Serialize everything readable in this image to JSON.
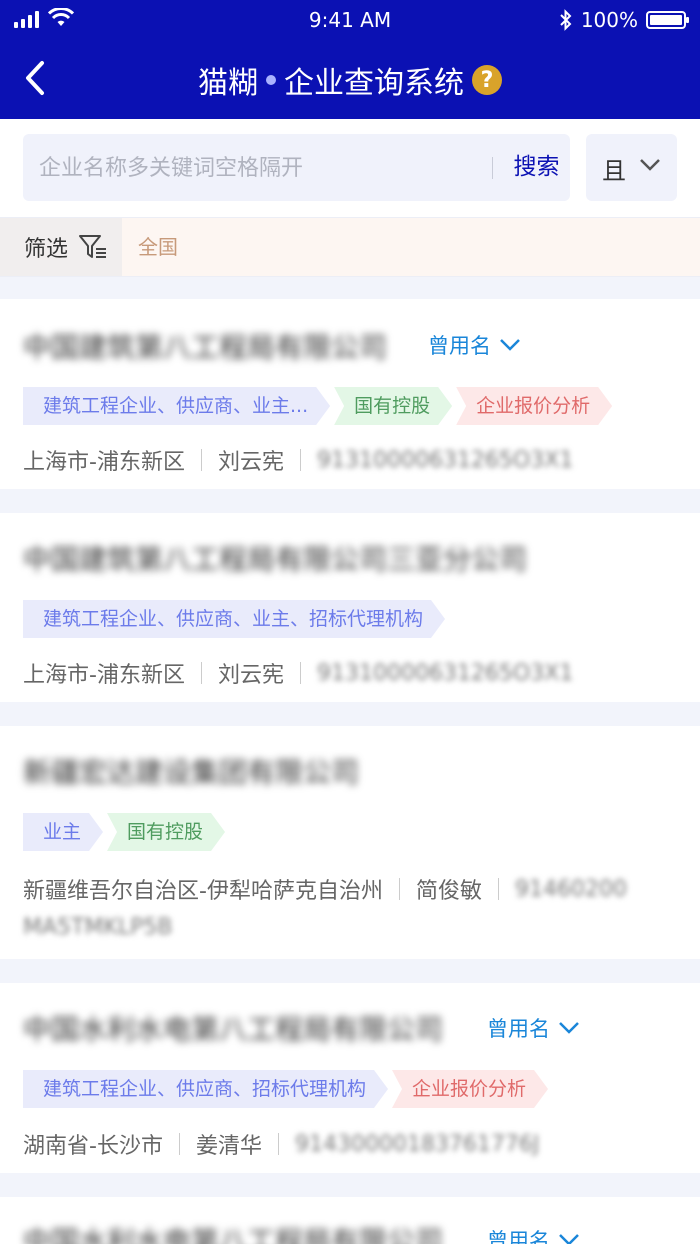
{
  "status_bar": {
    "time": "9:41 AM",
    "battery": "100%"
  },
  "nav": {
    "title_left": "猫糊",
    "title_right": "企业查询系统",
    "help": "?"
  },
  "search": {
    "placeholder": "企业名称多关键词空格隔开",
    "button": "搜索",
    "logic": "且"
  },
  "filter": {
    "label": "筛选",
    "region": "全国"
  },
  "companies": [
    {
      "name": "中国建筑第八工程局有限公司",
      "old_name": "曾用名",
      "tags": [
        "建筑工程企业、供应商、业主...",
        "国有控股",
        "企业报价分析"
      ],
      "region": "上海市-浦东新区",
      "person": "刘云宪",
      "code": "91310000631265O3X1"
    },
    {
      "name": "中国建筑第八工程局有限公司三亚分公司",
      "tags": [
        "建筑工程企业、供应商、业主、招标代理机构"
      ],
      "region": "上海市-浦东新区",
      "person": "刘云宪",
      "code": "91310000631265O3X1"
    },
    {
      "name": "新疆宏达建设集团有限公司",
      "tags": [
        "业主",
        "国有控股"
      ],
      "region": "新疆维吾尔自治区-伊犁哈萨克自治州",
      "person": "简俊敏",
      "code": "91460200",
      "code_line2": "MA5TMKLP5B"
    },
    {
      "name": "中国水利水电第八工程局有限公司",
      "old_name": "曾用名",
      "tags": [
        "建筑工程企业、供应商、招标代理机构",
        "企业报价分析"
      ],
      "region": "湖南省-长沙市",
      "person": "姜清华",
      "code": "914300001837617­76J"
    },
    {
      "name": "中国水利水电第八工程局有限公司",
      "old_name": "曾用名"
    }
  ],
  "colors": {
    "brand": "#0b11b3",
    "link": "#1a86d9"
  }
}
